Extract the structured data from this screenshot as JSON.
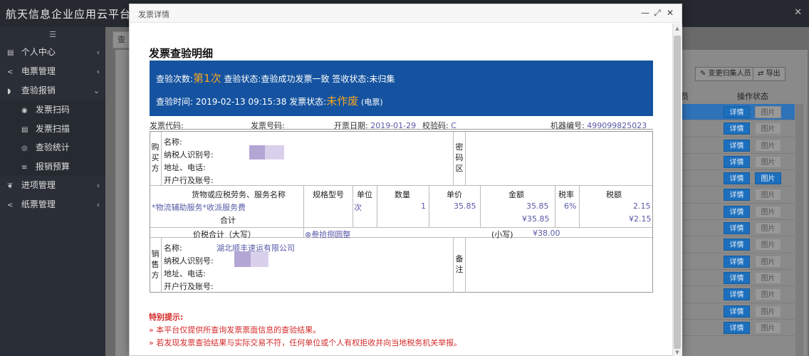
{
  "app": {
    "title": "航天信息企业应用云平台",
    "close_glyph": "✕"
  },
  "sidebar": {
    "toggle": "☰",
    "items": [
      {
        "label": "个人中心",
        "icon": "chart-icon",
        "glyph": "▤",
        "arrow": "‹"
      },
      {
        "label": "电票管理",
        "icon": "share-icon",
        "glyph": "<",
        "arrow": "‹"
      },
      {
        "label": "查验报销",
        "icon": "rss-icon",
        "glyph": "◗",
        "arrow": "⌄"
      }
    ],
    "sub_items": [
      {
        "label": "发票扫码",
        "icon": "eye-icon",
        "glyph": "◉"
      },
      {
        "label": "发票扫描",
        "icon": "chart-icon",
        "glyph": "▤"
      },
      {
        "label": "查验统计",
        "icon": "target-icon",
        "glyph": "◎"
      },
      {
        "label": "报销预算",
        "icon": "list-icon",
        "glyph": "≡"
      }
    ],
    "items2": [
      {
        "label": "进项管理",
        "icon": "leaf-icon",
        "glyph": "❦",
        "arrow": "‹"
      },
      {
        "label": "纸票管理",
        "icon": "share-icon",
        "glyph": "<",
        "arrow": "‹"
      }
    ]
  },
  "background": {
    "tab_label": "查",
    "change_collector_button": "变更归集人员",
    "export_button": "导出",
    "col_partial": "员",
    "col_operation": "操作状态",
    "detail_label": "详情",
    "picture_label": "图片",
    "row_count": 14
  },
  "modal": {
    "title": "发票详情",
    "controls": {
      "minimize": "—",
      "maximize": "⤢",
      "close": "✕"
    },
    "heading": "发票查验明细",
    "banner": {
      "verify_count_label": "查验次数:",
      "verify_count_value": "第1次",
      "verify_status_label": "查验状态:",
      "verify_status_value": "查验成功发票一致",
      "sign_status_label": "签收状态:",
      "sign_status_value": "未归集",
      "verify_time_label": "查验时间:",
      "verify_time_value": "2019-02-13 09:15:38",
      "invoice_status_label": "发票状态:",
      "invoice_status_value": "未作废",
      "invoice_type": "(电票)"
    },
    "meta": {
      "code_label": "发票代码:",
      "number_label": "发票号码:",
      "date_label": "开票日期:",
      "date_value": "2019-01-29",
      "check_label": "校验码:",
      "check_value": "C",
      "machine_label": "机器编号:",
      "machine_value": "499099825023"
    },
    "buyer": {
      "section": "购买方",
      "name_label": "名称:",
      "tax_id_label": "纳税人识别号:",
      "addr_label": "地址、电话:",
      "bank_label": "开户行及账号:",
      "password_area": "密码区"
    },
    "items_header": {
      "goods": "货物或应税劳务、服务名称",
      "spec": "规格型号",
      "unit": "单位",
      "qty": "数量",
      "price": "单价",
      "amount": "金额",
      "tax_rate": "税率",
      "tax": "税额"
    },
    "item_row": {
      "goods": "*物流辅助服务*收派服务费",
      "unit": "次",
      "qty": "1",
      "price": "35.85",
      "amount": "35.85",
      "tax_rate": "6%",
      "tax": "2.15"
    },
    "subtotal": {
      "label": "合计",
      "amount": "¥35.85",
      "tax": "¥2.15"
    },
    "total": {
      "label": "价税合计（大写）",
      "words": "⊗叁拾捌圆整",
      "small_label": "(小写)",
      "small_value": "¥38.00"
    },
    "seller": {
      "section": "销售方",
      "name_label": "名称:",
      "name_value": "湖北顺丰速运有限公司",
      "tax_id_label": "纳税人识别号:",
      "addr_label": "地址、电话:",
      "bank_label": "开户行及账号:",
      "remark": "备注"
    },
    "notice": {
      "title": "特别提示:",
      "line1": "» 本平台仅提供所查询发票票面信息的查验结果。",
      "line2": "» 若发现发票查验结果与实际交易不符，任何单位或个人有权拒收并向当地税务机关举报。"
    }
  }
}
